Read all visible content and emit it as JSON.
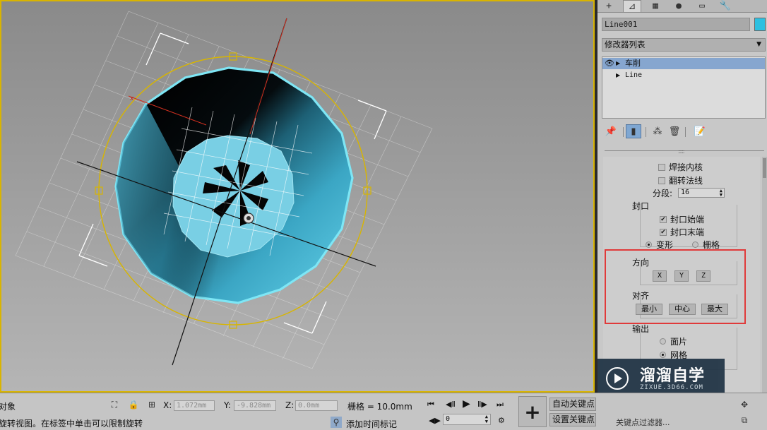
{
  "viewport": {
    "accent_border": "#d9b400",
    "object_color": "#2ec0e0"
  },
  "panel": {
    "tabs": [
      {
        "icon": "create-icon",
        "glyph": "+"
      },
      {
        "icon": "modify-icon",
        "glyph": "⊿"
      },
      {
        "icon": "hierarchy-icon",
        "glyph": "▦"
      },
      {
        "icon": "motion-icon",
        "glyph": "●"
      },
      {
        "icon": "display-icon",
        "glyph": "▭"
      },
      {
        "icon": "utilities-icon",
        "glyph": "🔧"
      }
    ],
    "object_name": "Line001",
    "modifier_list": "修改器列表",
    "stack": [
      {
        "label": "车削",
        "selected": true
      },
      {
        "label": "Line",
        "selected": false
      }
    ],
    "params": {
      "weld_core": "焊接内核",
      "flip_normals": "翻转法线",
      "segments_label": "分段:",
      "segments_value": "16",
      "capping_title": "封口",
      "cap_start": "封口始端",
      "cap_end": "封口末端",
      "morph": "变形",
      "grid": "栅格",
      "direction_title": "方向",
      "dir_x": "X",
      "dir_y": "Y",
      "dir_z": "Z",
      "align_title": "对齐",
      "align_min": "最小",
      "align_center": "中心",
      "align_max": "最大",
      "output_title": "输出",
      "patch": "面片",
      "mesh": "网格"
    }
  },
  "watermark": {
    "title": "溜溜自学",
    "url": "ZIXUE.3D66.COM"
  },
  "bottom": {
    "selection_status": "对象",
    "prompt": "旋转视图。在标签中单击可以限制旋转",
    "x_label": "X:",
    "x_value": "1.072mm",
    "y_label": "Y:",
    "y_value": "-9.828mm",
    "z_label": "Z:",
    "z_value": "0.0mm",
    "grid_label": "栅格 = 10.0mm",
    "add_time_tag": "添加时间标记",
    "auto_key": "自动关键点",
    "set_key": "设置关键点",
    "frame_value": "0",
    "key_filters": "关键点过滤器..."
  }
}
